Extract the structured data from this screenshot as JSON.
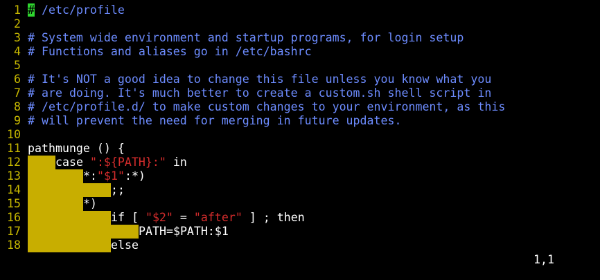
{
  "editor": {
    "lines": [
      {
        "n": "1",
        "parts": [
          {
            "c": "cursor",
            "t": "#"
          },
          {
            "c": "comment",
            "t": " /etc/profile"
          }
        ]
      },
      {
        "n": "2",
        "parts": []
      },
      {
        "n": "3",
        "parts": [
          {
            "c": "comment",
            "t": "# System wide environment and startup programs, for login setup"
          }
        ]
      },
      {
        "n": "4",
        "parts": [
          {
            "c": "comment",
            "t": "# Functions and aliases go in /etc/bashrc"
          }
        ]
      },
      {
        "n": "5",
        "parts": []
      },
      {
        "n": "6",
        "parts": [
          {
            "c": "comment",
            "t": "# It's NOT a good idea to change this file unless you know what you"
          }
        ]
      },
      {
        "n": "7",
        "parts": [
          {
            "c": "comment",
            "t": "# are doing. It's much better to create a custom.sh shell script in"
          }
        ]
      },
      {
        "n": "8",
        "parts": [
          {
            "c": "comment",
            "t": "# /etc/profile.d/ to make custom changes to your environment, as this"
          }
        ]
      },
      {
        "n": "9",
        "parts": [
          {
            "c": "comment",
            "t": "# will prevent the need for merging in future updates."
          }
        ]
      },
      {
        "n": "10",
        "parts": []
      },
      {
        "n": "11",
        "parts": [
          {
            "c": "plain",
            "t": "pathmunge () {"
          }
        ]
      },
      {
        "n": "12",
        "tabs": 1,
        "parts": [
          {
            "c": "plain",
            "t": "case "
          },
          {
            "c": "str",
            "t": "\":${PATH}:\""
          },
          {
            "c": "plain",
            "t": " in"
          }
        ]
      },
      {
        "n": "13",
        "tabs": 2,
        "parts": [
          {
            "c": "plain",
            "t": "*:"
          },
          {
            "c": "str",
            "t": "\"$1\""
          },
          {
            "c": "plain",
            "t": ":*)"
          }
        ]
      },
      {
        "n": "14",
        "tabs": 3,
        "parts": [
          {
            "c": "plain",
            "t": ";;"
          }
        ]
      },
      {
        "n": "15",
        "tabs": 2,
        "parts": [
          {
            "c": "plain",
            "t": "*)"
          }
        ]
      },
      {
        "n": "16",
        "tabs": 3,
        "parts": [
          {
            "c": "plain",
            "t": "if [ "
          },
          {
            "c": "str",
            "t": "\"$2\""
          },
          {
            "c": "plain",
            "t": " = "
          },
          {
            "c": "str",
            "t": "\"after\""
          },
          {
            "c": "plain",
            "t": " ] ; then"
          }
        ]
      },
      {
        "n": "17",
        "tabs": 4,
        "parts": [
          {
            "c": "plain",
            "t": "PATH=$PATH:$1"
          }
        ]
      },
      {
        "n": "18",
        "tabs": 3,
        "parts": [
          {
            "c": "plain",
            "t": "else"
          }
        ]
      }
    ]
  },
  "status": {
    "ruler": "1,1"
  },
  "colors": {
    "background": "#000000",
    "line_number": "#c8b900",
    "comment": "#6d8cff",
    "string": "#d42c2c",
    "tab_highlight": "#c8ae00",
    "cursor": "#2fd62f"
  }
}
